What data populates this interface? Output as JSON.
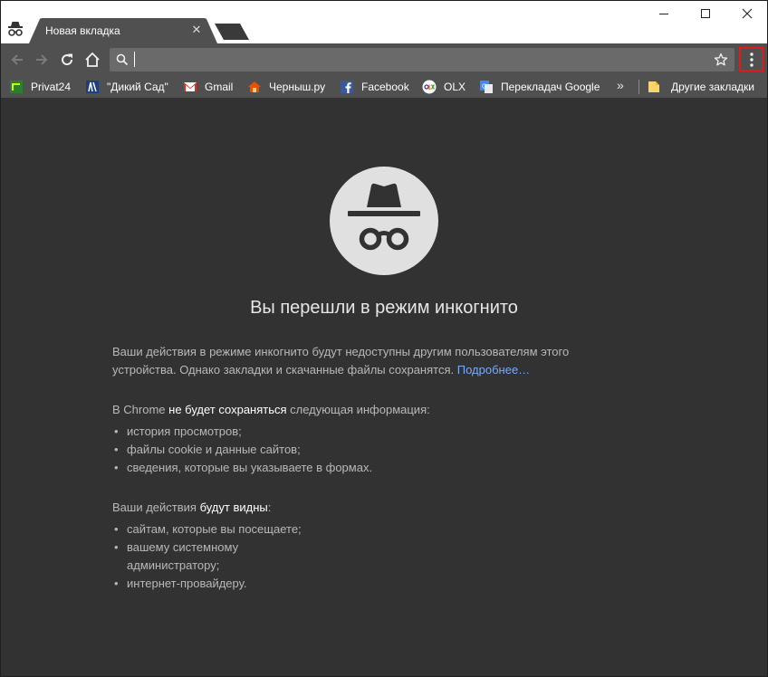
{
  "tab": {
    "title": "Новая вкладка",
    "close_glyph": "✕"
  },
  "toolbar": {
    "address_value": "",
    "address_placeholder": ""
  },
  "bookmarks": {
    "items": [
      {
        "label": "Privat24",
        "icon": "privat24-icon"
      },
      {
        "label": "\"Дикий Сад\"",
        "icon": "wild-garden-icon"
      },
      {
        "label": "Gmail",
        "icon": "gmail-icon"
      },
      {
        "label": "Черныш.ру",
        "icon": "chernysh-icon"
      },
      {
        "label": "Facebook",
        "icon": "facebook-icon"
      },
      {
        "label": "OLX",
        "icon": "olx-icon"
      },
      {
        "label": "Перекладач Google",
        "icon": "google-translate-icon"
      }
    ],
    "more": "»",
    "other": "Другие закладки"
  },
  "content": {
    "heading": "Вы перешли в режим инкогнито",
    "intro_line1": "Ваши действия в режиме инкогнито будут недоступны другим пользователям этого",
    "intro_line2": "устройства. Однако закладки и скачанные файлы сохранятся.",
    "learn_more": "Подробнее…",
    "not_saved_prefix": "В Chrome",
    "not_saved_bold": "не будет сохраняться",
    "not_saved_suffix": "следующая информация:",
    "not_saved_items": [
      "история просмотров;",
      "файлы cookie и данные сайтов;",
      "сведения, которые вы указываете в формах."
    ],
    "visible_prefix": "Ваши действия",
    "visible_bold": "будут видны",
    "visible_suffix": ":",
    "visible_items": [
      "сайтам, которые вы посещаете;",
      "вашему системному",
      "администратору;",
      "интернет-провайдеру."
    ]
  },
  "colors": {
    "background": "#323232",
    "toolbar": "#505050",
    "link": "#7baaf7",
    "highlight_box": "#e01b1b"
  }
}
